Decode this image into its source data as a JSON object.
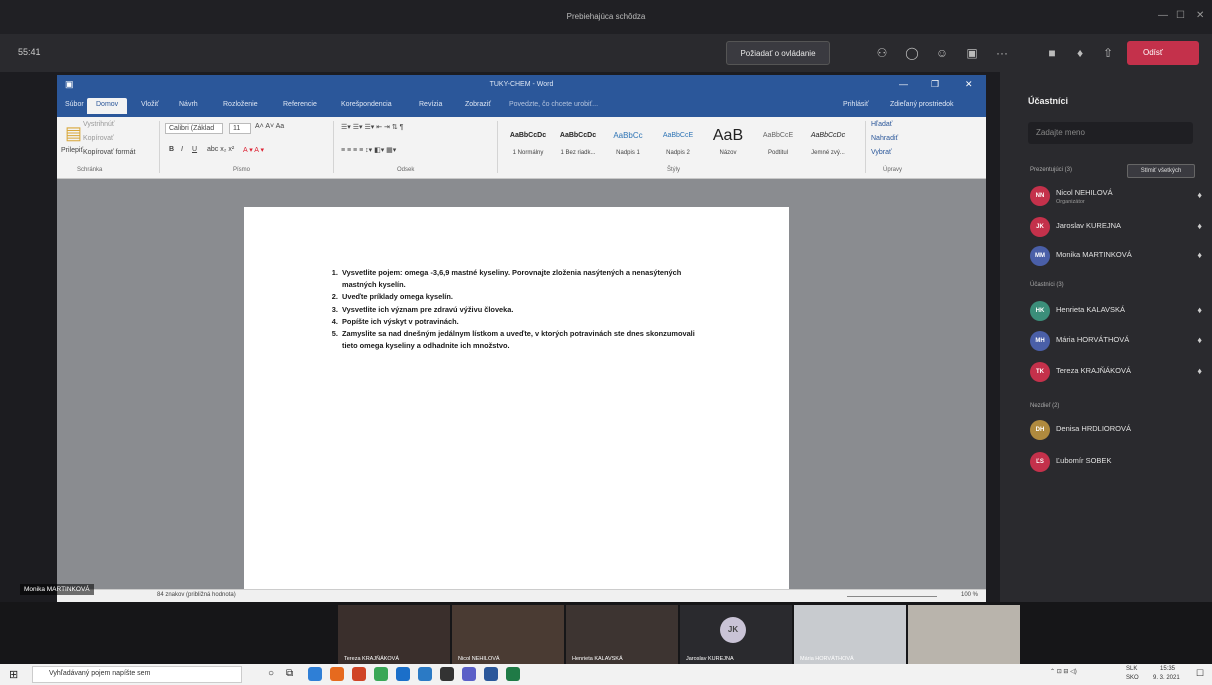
{
  "teams": {
    "window_title": "Prebiehajúca schôdza",
    "timer": "55:41",
    "request_control": "Požiadať o ovládanie",
    "leave_label": "Odísť"
  },
  "word": {
    "doc_title": "TUKY-CHEM - Word",
    "tabs": [
      "Súbor",
      "Domov",
      "Vložiť",
      "Návrh",
      "Rozloženie",
      "Referencie",
      "Korešpondencia",
      "Revízia",
      "Zobraziť"
    ],
    "tell_me": "Povedzte, čo chcete urobiť...",
    "share": "Prihlásiť",
    "signin": "Zdieľaný prostriedok",
    "ribbon": {
      "paste": "Prilepiť",
      "cut": "Vystrihnúť",
      "copy": "Kopírovať",
      "format_painter": "Kopírovať formát",
      "font_name": "Calibri (Základ",
      "font_size": "11",
      "find": "Hľadať",
      "replace": "Nahradiť",
      "select": "Vybrať",
      "groups": [
        "Schránka",
        "Písmo",
        "Odsek",
        "Štýly",
        "Úpravy"
      ],
      "styles": [
        {
          "preview": "AaBbCcDc",
          "name": "1 Normálny"
        },
        {
          "preview": "AaBbCcDc",
          "name": "1 Bez riadk..."
        },
        {
          "preview": "AaBbCc",
          "name": "Nadpis 1"
        },
        {
          "preview": "AaBbCcE",
          "name": "Nadpis 2"
        },
        {
          "preview": "AaB",
          "name": "Názov"
        },
        {
          "preview": "AaBbCcE",
          "name": "Podtitul"
        },
        {
          "preview": "AaBbCcDc",
          "name": "Jemné zvý..."
        }
      ]
    },
    "doc_items": [
      "Vysvetlite pojem: omega -3,6,9 mastné kyseliny. Porovnajte zloženia nasýtených a nenasýtených mastných kyselín.",
      "Uveďte príklady omega kyselín.",
      "Vysvetlite ich význam pre zdravú výživu človeka.",
      "Popíšte ich výskyt v potravinách.",
      "Zamyslite sa nad dnešným jedálnym lístkom a uveďte, v ktorých potravinách ste dnes skonzumovali tieto omega kyseliny a odhadnite ich množstvo."
    ],
    "status_word_count": "84 znakov (približná hodnota)",
    "zoom": "100 %"
  },
  "participants": {
    "title": "Účastníci",
    "search_placeholder": "Zadajte meno",
    "mute_all": "Stlmiť všetkých",
    "presenters_header": "Prezentujúci (3)",
    "attendees_header": "Účastníci (3)",
    "others_header": "Nezdieľ (2)",
    "presenters": [
      {
        "initials": "NN",
        "name": "Nicol NEHILOVÁ",
        "role": "Organizátor",
        "color": "#c4314b"
      },
      {
        "initials": "JK",
        "name": "Jaroslav KUREJNA",
        "role": "",
        "color": "#c4314b"
      },
      {
        "initials": "MM",
        "name": "Monika MARTINKOVÁ",
        "role": "",
        "color": "#4a5fa8"
      }
    ],
    "attendees": [
      {
        "initials": "HK",
        "name": "Henrieta KALAVSKÁ",
        "role": "",
        "color": "#3b8e7a"
      },
      {
        "initials": "MH",
        "name": "Mária HORVÁTHOVÁ",
        "role": "",
        "color": "#4a5fa8"
      },
      {
        "initials": "TK",
        "name": "Tereza KRAJŇÁKOVÁ",
        "role": "",
        "color": "#c4314b"
      }
    ],
    "others": [
      {
        "initials": "DH",
        "name": "Denisa HRDLIOROVÁ",
        "role": "",
        "color": "#b08a3e"
      },
      {
        "initials": "ĽS",
        "name": "Ľubomír SOBEK",
        "role": "",
        "color": "#c4314b"
      }
    ]
  },
  "video": {
    "nameplate": "Monika MARTINKOVÁ",
    "jk_initials": "JK",
    "tiles": [
      "Tereza KRAJŇÁKOVÁ",
      "Nicol NEHILOVÁ",
      "Henrieta KALAVSKÁ",
      "Jaroslav KUREJNA",
      "Mária HORVÁTHOVÁ",
      ""
    ]
  },
  "taskbar": {
    "search": "Vyhľadávaný pojem napíšte sem",
    "lang": "SLK",
    "lang2": "SKO",
    "time": "15:35",
    "date": "9. 3. 2021"
  }
}
